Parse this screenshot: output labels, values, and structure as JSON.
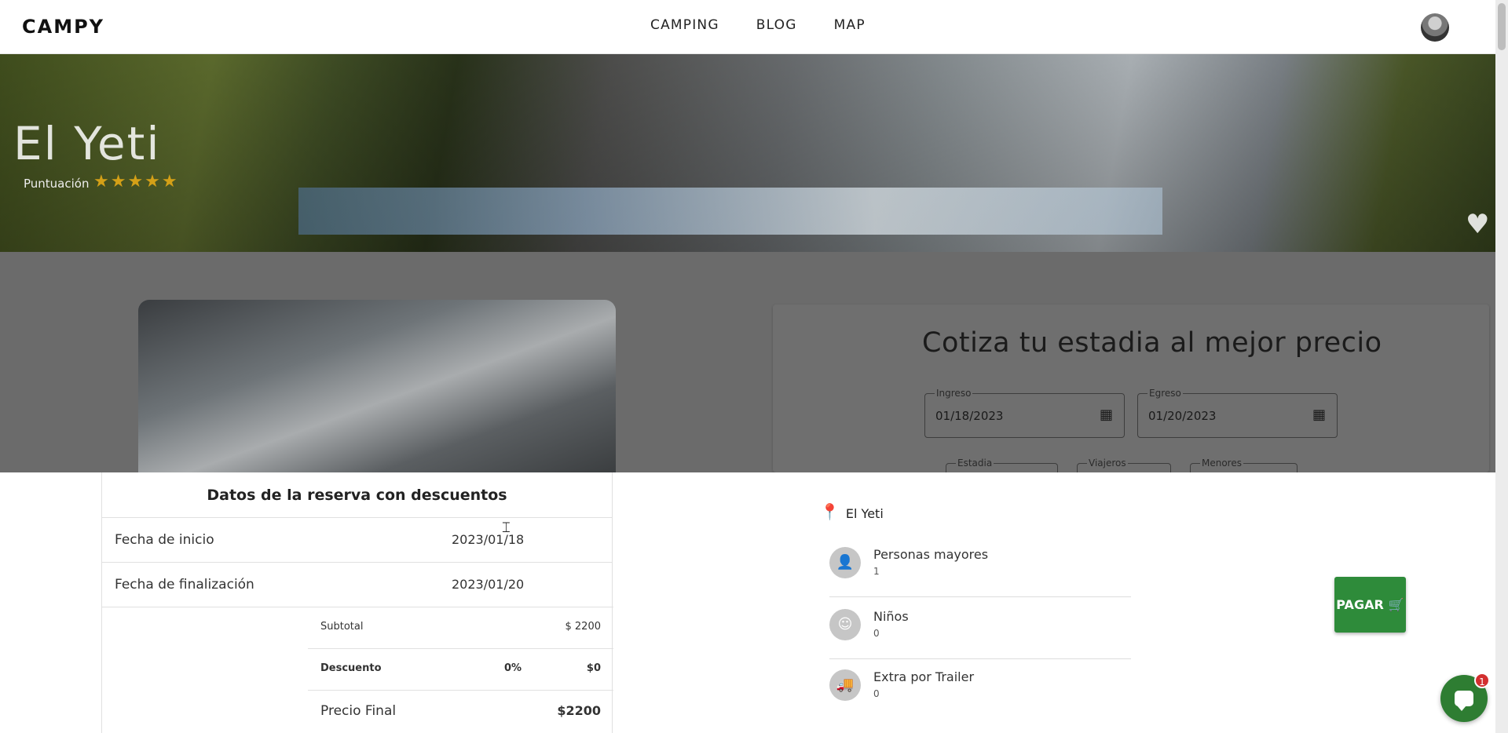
{
  "header": {
    "logo": "CAMPY",
    "nav": [
      "CAMPING",
      "BLOG",
      "MAP"
    ]
  },
  "hero": {
    "title": "El Yeti",
    "rating_label": "Puntuación",
    "stars": "★★★★★",
    "rating": 5
  },
  "quote": {
    "title": "Cotiza tu estadia al mejor precio",
    "checkin_label": "Ingreso",
    "checkin_value": "01/18/2023",
    "checkout_label": "Egreso",
    "checkout_value": "01/20/2023",
    "stay_label": "Estadia",
    "travelers_label": "Viajeros",
    "minors_label": "Menores"
  },
  "summary": {
    "title": "Datos de la reserva con descuentos",
    "start_label": "Fecha de inicio",
    "start_value": "2023/01/18",
    "end_label": "Fecha de finalización",
    "end_value": "2023/01/20",
    "subtotal_label": "Subtotal",
    "subtotal_value": "$ 2200",
    "discount_label": "Descuento",
    "discount_percent": "0%",
    "discount_value": "$0",
    "final_label": "Precio Final",
    "final_value": "$2200"
  },
  "details": {
    "location": "El Yeti",
    "adults_label": "Personas mayores",
    "adults_value": "1",
    "kids_label": "Niños",
    "kids_value": "0",
    "trailer_label": "Extra por Trailer",
    "trailer_value": "0"
  },
  "actions": {
    "pay_label": "PAGAR",
    "chat_badge": "1"
  },
  "colors": {
    "pay_button": "#2e8b3a",
    "star": "#d4a017",
    "badge": "#d32f2f"
  }
}
